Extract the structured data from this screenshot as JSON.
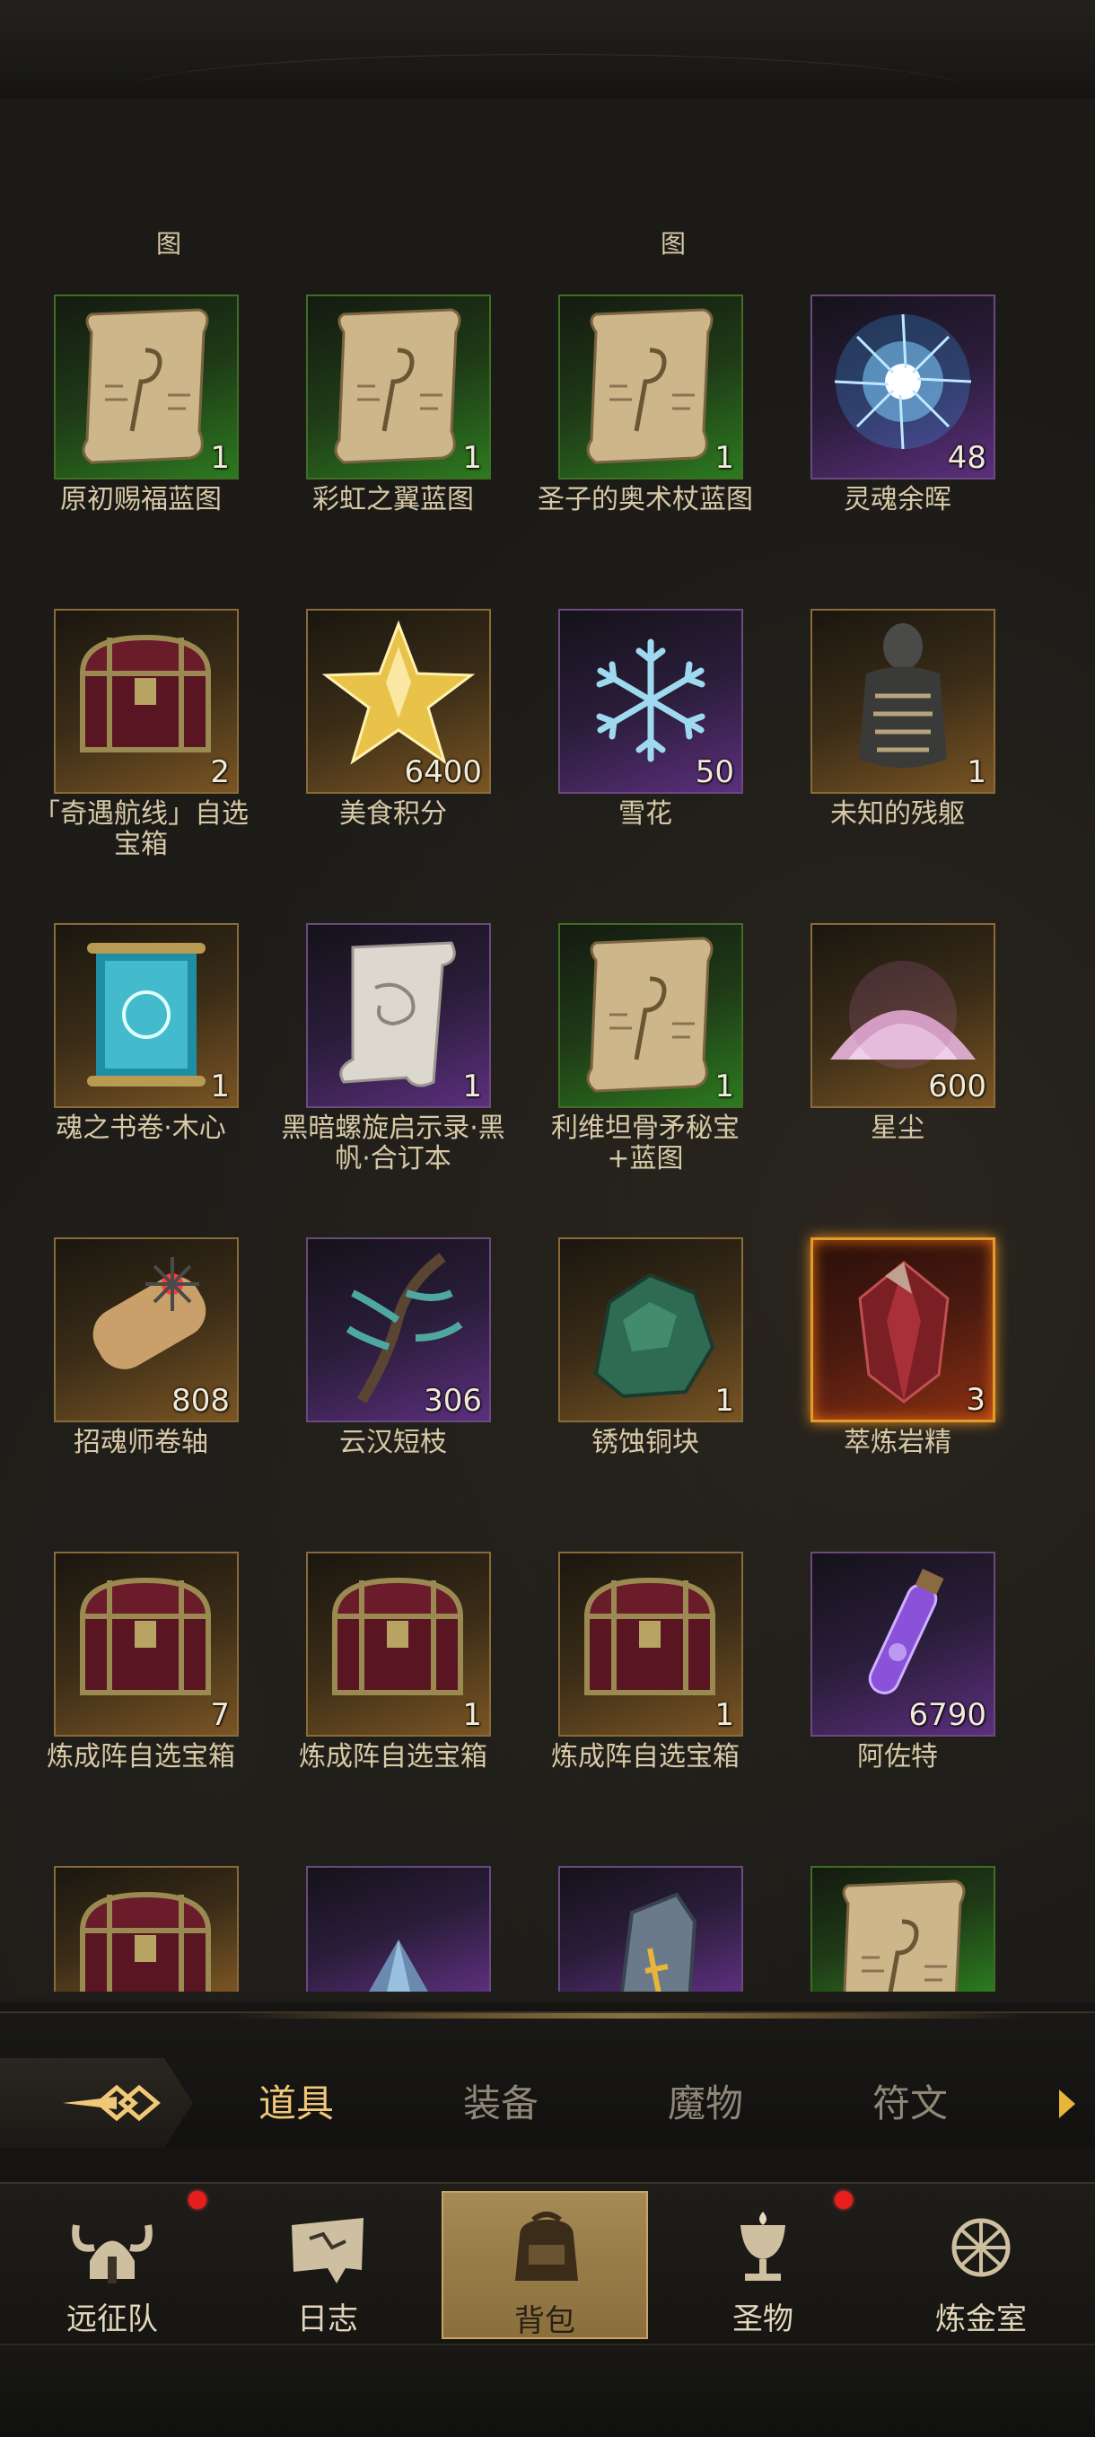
{
  "clipped_labels": [
    "图",
    "图"
  ],
  "items": [
    {
      "name": "原初赐福蓝图",
      "qty": "1",
      "rarity": "green",
      "icon": "blueprint-scroll-icon"
    },
    {
      "name": "彩虹之翼蓝图",
      "qty": "1",
      "rarity": "green",
      "icon": "blueprint-scroll-icon"
    },
    {
      "name": "圣子的奥术杖蓝图",
      "qty": "1",
      "rarity": "green",
      "icon": "blueprint-scroll-icon"
    },
    {
      "name": "灵魂余晖",
      "qty": "48",
      "rarity": "purple",
      "icon": "soul-glow-icon"
    },
    {
      "name": "「奇遇航线」自选宝箱",
      "qty": "2",
      "rarity": "gold",
      "icon": "treasure-chest-icon"
    },
    {
      "name": "美食积分",
      "qty": "6400",
      "rarity": "gold",
      "icon": "gold-star-icon"
    },
    {
      "name": "雪花",
      "qty": "50",
      "rarity": "purple",
      "icon": "snowflake-icon"
    },
    {
      "name": "未知的残躯",
      "qty": "1",
      "rarity": "gold",
      "icon": "remains-icon"
    },
    {
      "name": "魂之书卷·木心",
      "qty": "1",
      "rarity": "gold",
      "icon": "glowing-scroll-icon"
    },
    {
      "name": "黑暗螺旋启示录·黑帆·合订本",
      "qty": "1",
      "rarity": "purple",
      "icon": "white-scroll-icon"
    },
    {
      "name": "利维坦骨矛秘宝+蓝图",
      "qty": "1",
      "rarity": "green",
      "icon": "blueprint-scroll-icon"
    },
    {
      "name": "星尘",
      "qty": "600",
      "rarity": "gold",
      "icon": "stardust-icon"
    },
    {
      "name": "招魂师卷轴",
      "qty": "808",
      "rarity": "gold",
      "icon": "rolled-scroll-icon"
    },
    {
      "name": "云汉短枝",
      "qty": "306",
      "rarity": "purple",
      "icon": "branch-icon"
    },
    {
      "name": "锈蚀铜块",
      "qty": "1",
      "rarity": "gold",
      "icon": "copper-ore-icon"
    },
    {
      "name": "萃炼岩精",
      "qty": "3",
      "rarity": "orange",
      "icon": "red-crystal-icon"
    },
    {
      "name": "炼成阵自选宝箱",
      "qty": "7",
      "rarity": "gold",
      "icon": "treasure-chest-icon"
    },
    {
      "name": "炼成阵自选宝箱",
      "qty": "1",
      "rarity": "gold",
      "icon": "treasure-chest-icon"
    },
    {
      "name": "炼成阵自选宝箱",
      "qty": "1",
      "rarity": "gold",
      "icon": "treasure-chest-icon"
    },
    {
      "name": "阿佐特",
      "qty": "6790",
      "rarity": "purple",
      "icon": "potion-vial-icon"
    }
  ],
  "partial_items": [
    {
      "rarity": "gold",
      "icon": "treasure-chest-icon"
    },
    {
      "rarity": "purple",
      "icon": "pyramid-gem-icon"
    },
    {
      "rarity": "purple",
      "icon": "rune-stone-icon"
    },
    {
      "rarity": "green",
      "icon": "blueprint-scroll-icon"
    }
  ],
  "tabs": [
    {
      "label": "道具",
      "active": true
    },
    {
      "label": "装备",
      "active": false
    },
    {
      "label": "魔物",
      "active": false
    },
    {
      "label": "符文",
      "active": false
    }
  ],
  "nav": [
    {
      "label": "远征队",
      "icon": "viking-helmet-icon",
      "notify": true,
      "active": false
    },
    {
      "label": "日志",
      "icon": "map-scroll-icon",
      "notify": false,
      "active": false
    },
    {
      "label": "背包",
      "icon": "backpack-icon",
      "notify": false,
      "active": true
    },
    {
      "label": "圣物",
      "icon": "chalice-icon",
      "notify": true,
      "active": false
    },
    {
      "label": "炼金室",
      "icon": "alchemy-icon",
      "notify": false,
      "active": false
    }
  ],
  "colors": {
    "accent": "#f0c877",
    "tab_inactive": "#8f8777",
    "notify": "#e81d1d",
    "rarity_green": "#2c7a1f",
    "rarity_purple": "#5c2f7d",
    "rarity_gold": "#7a5524",
    "rarity_orange": "#e39a2a"
  }
}
